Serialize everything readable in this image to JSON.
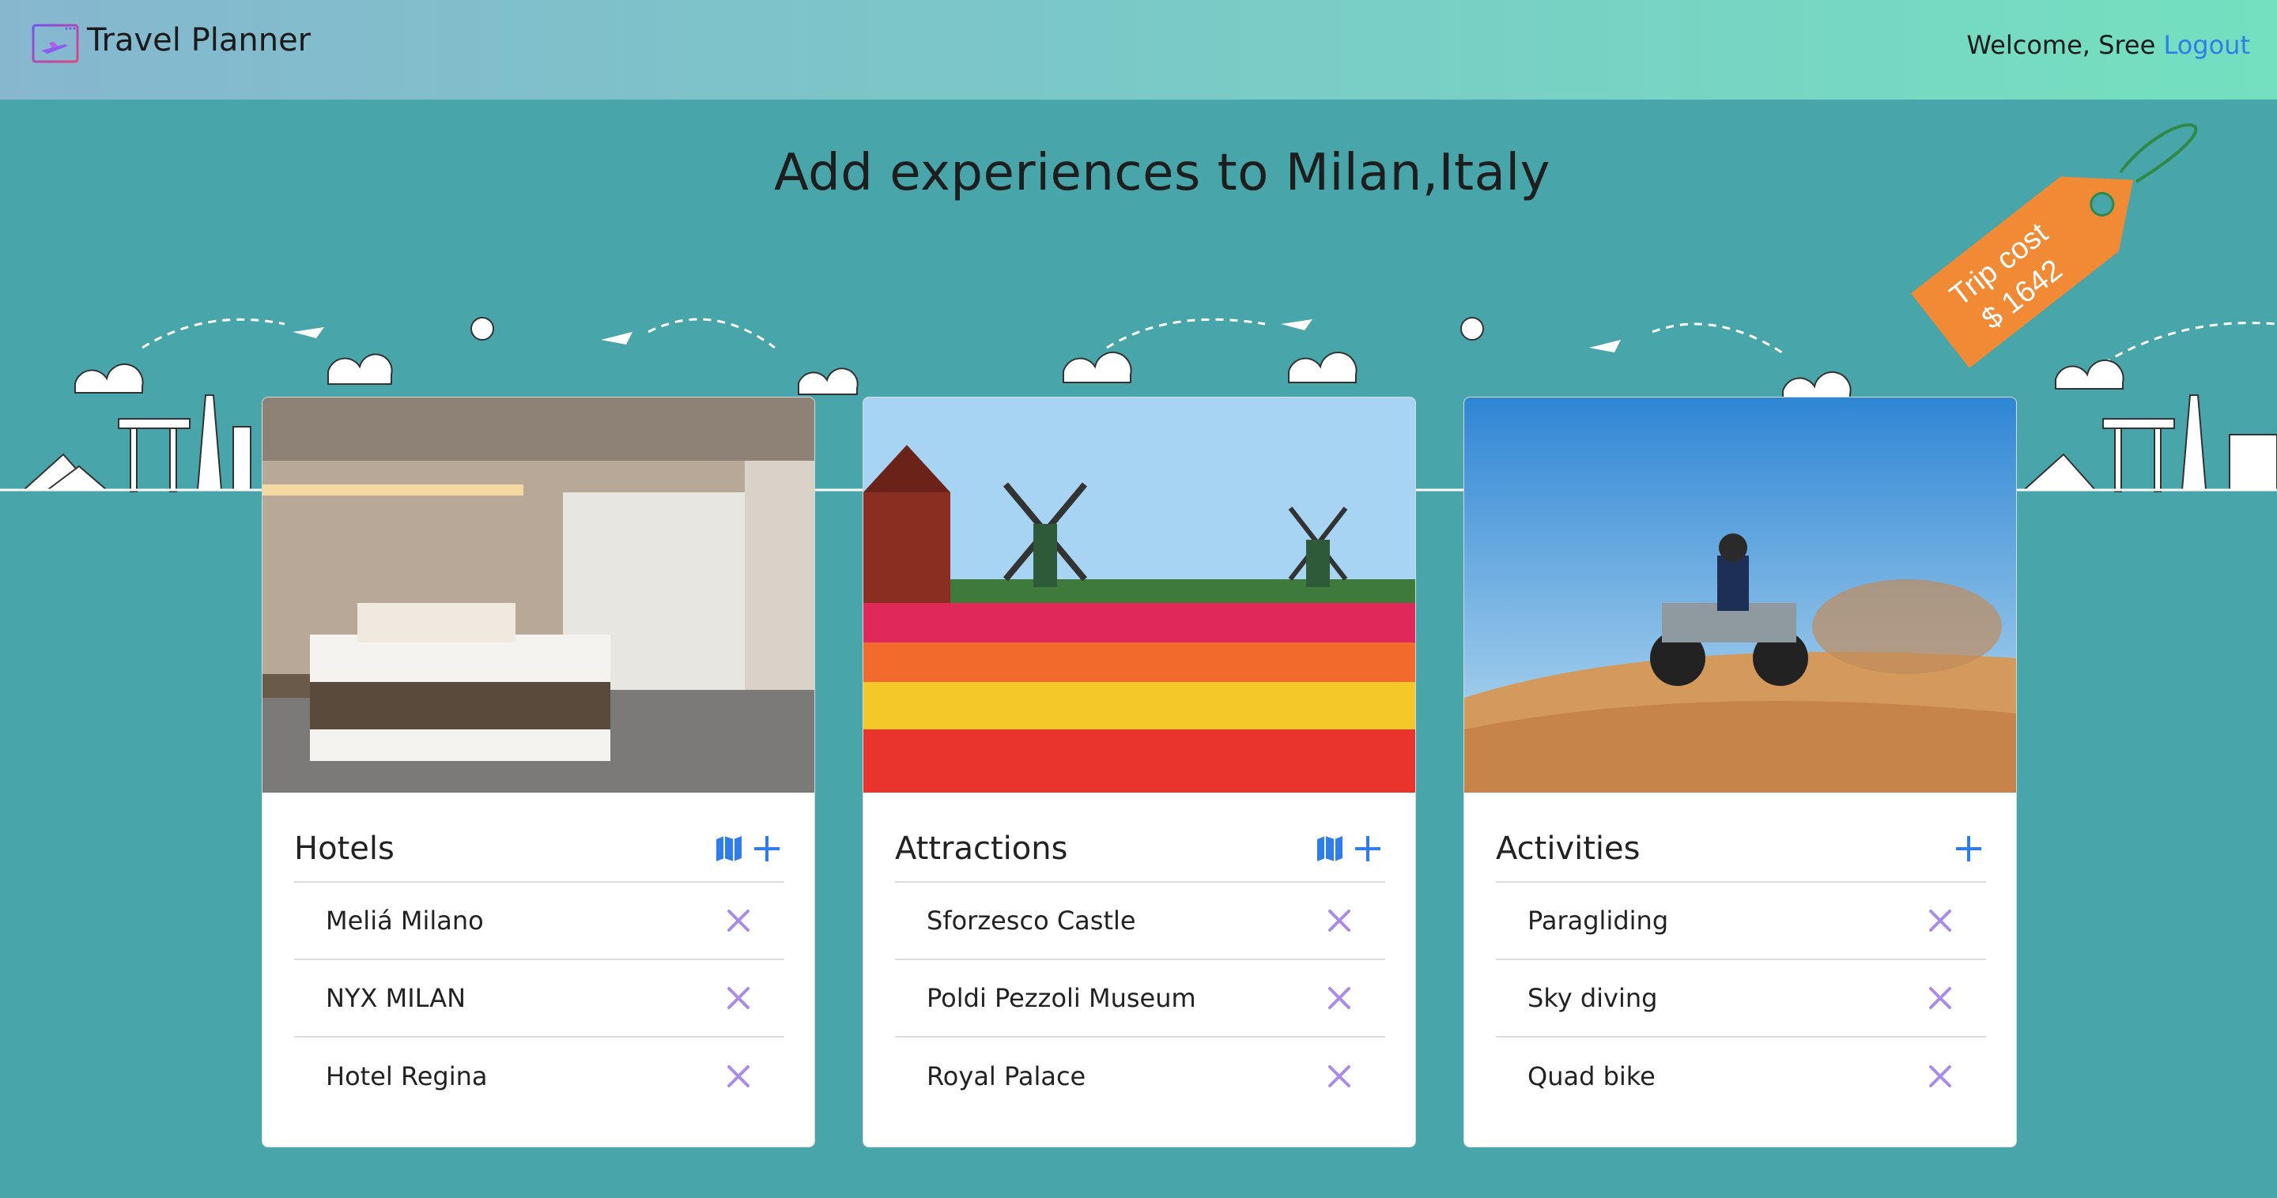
{
  "app": {
    "title": "Travel Planner"
  },
  "user": {
    "welcome": "Welcome, Sree",
    "logout": "Logout"
  },
  "page": {
    "title": "Add experiences to Milan,Italy"
  },
  "trip_cost": {
    "label": "Trip cost",
    "amount": "$ 1642",
    "tag_color": "#f08a35"
  },
  "cards": {
    "hotels": {
      "title": "Hotels",
      "items": [
        "Meliá Milano",
        "NYX MILAN",
        "Hotel Regina"
      ]
    },
    "attractions": {
      "title": "Attractions",
      "items": [
        "Sforzesco Castle",
        "Poldi Pezzoli Museum",
        "Royal Palace"
      ]
    },
    "activities": {
      "title": "Activities",
      "items": [
        "Paragliding",
        "Sky diving",
        "Quad bike"
      ]
    }
  },
  "icons": {
    "map": "map-icon",
    "add": "plus-icon",
    "remove": "close-icon"
  },
  "colors": {
    "accent": "#2f7de9",
    "remove": "#a98be8",
    "background": "#48a5a9"
  }
}
